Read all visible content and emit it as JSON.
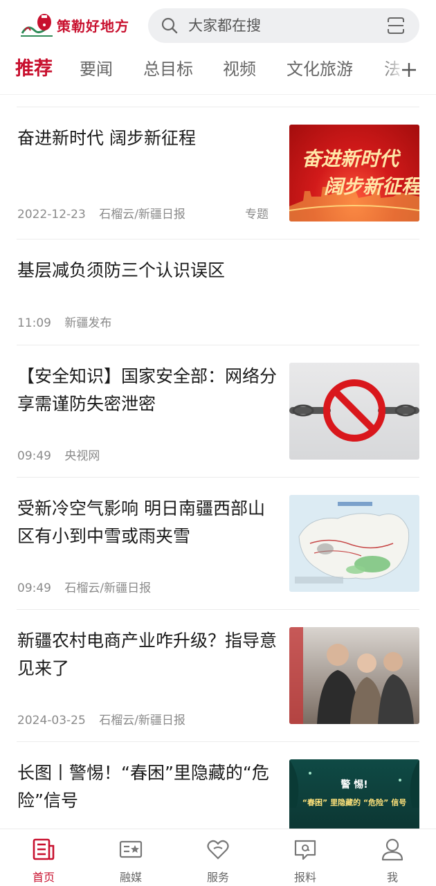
{
  "header": {
    "logo_text": "策勒好地方",
    "search_placeholder": "大家都在搜"
  },
  "tabs": [
    {
      "label": "推荐",
      "active": true
    },
    {
      "label": "要闻"
    },
    {
      "label": "总目标"
    },
    {
      "label": "视频"
    },
    {
      "label": "文化旅游"
    },
    {
      "label": "法"
    }
  ],
  "feed": [
    {
      "title": "奋进新时代 阔步新征程",
      "date": "2022-12-23",
      "source": "石榴云/新疆日报",
      "tag": "专题",
      "thumb_text_1": "奋进新时代",
      "thumb_text_2": "阔步新征程"
    },
    {
      "title": "基层减负须防三个认识误区",
      "date": "11:09",
      "source": "新疆发布"
    },
    {
      "title": "【安全知识】国家安全部：网络分享需谨防失密泄密",
      "date": "09:49",
      "source": "央视网"
    },
    {
      "title": "受新冷空气影响 明日南疆西部山区有小到中雪或雨夹雪",
      "date": "09:49",
      "source": "石榴云/新疆日报"
    },
    {
      "title": "新疆农村电商产业咋升级？指导意见来了",
      "date": "2024-03-25",
      "source": "石榴云/新疆日报"
    },
    {
      "title": "长图丨警惕！“春困”里隐藏的“危险”信号",
      "thumb_text_1": "警 惕!",
      "thumb_text_2": "“春困” 里隐藏的 “危险” 信号"
    }
  ],
  "bottom_nav": [
    {
      "label": "首页",
      "icon": "home-news-icon",
      "active": true
    },
    {
      "label": "融媒",
      "icon": "media-card-icon"
    },
    {
      "label": "服务",
      "icon": "heart-service-icon"
    },
    {
      "label": "报料",
      "icon": "report-chat-icon"
    },
    {
      "label": "我",
      "icon": "user-profile-icon"
    }
  ],
  "colors": {
    "accent": "#c8102e",
    "muted_text": "#8a8a8a",
    "search_bg": "#eeeff1"
  }
}
